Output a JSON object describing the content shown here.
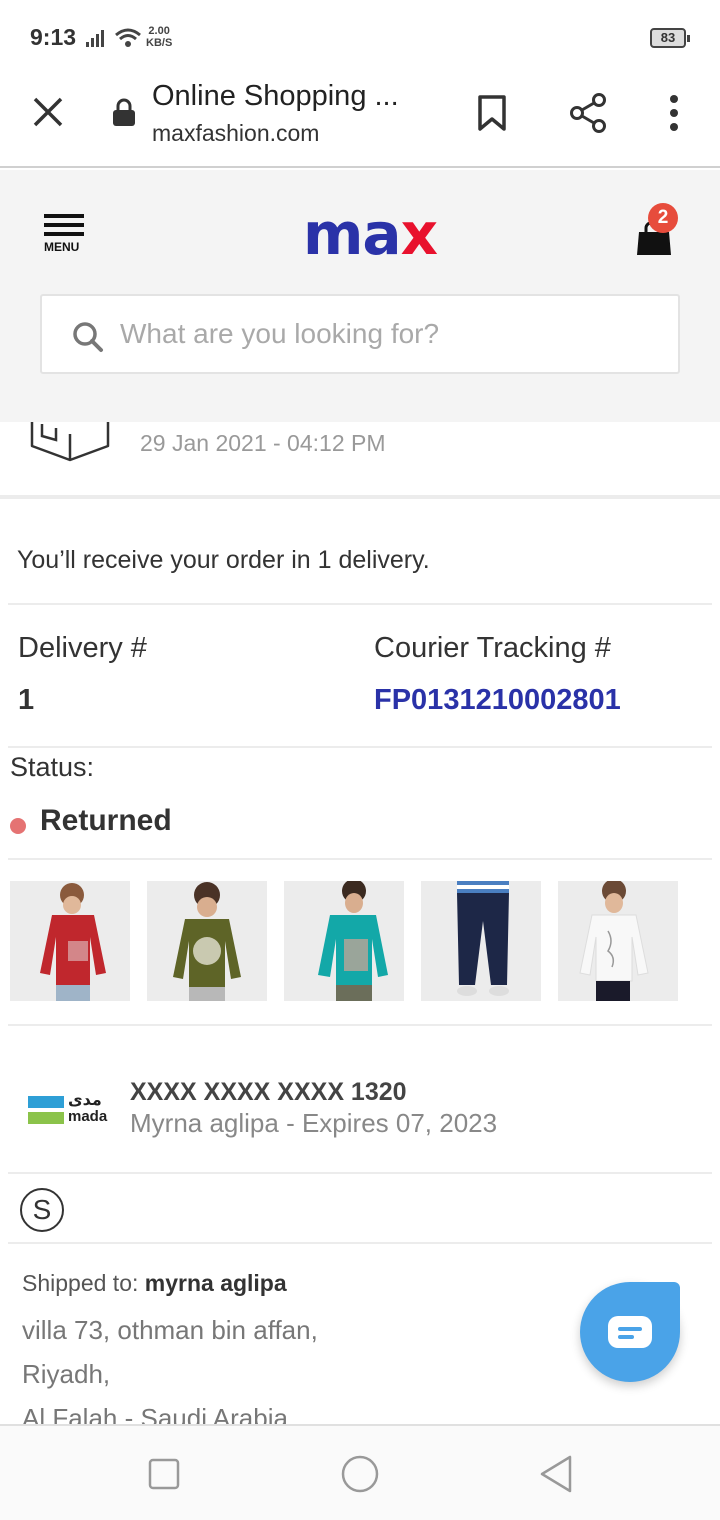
{
  "status_bar": {
    "time": "9:13",
    "net_speed_value": "2.00",
    "net_speed_unit": "KB/S",
    "battery": "83"
  },
  "browser": {
    "title": "Online Shopping ...",
    "url": "maxfashion.com"
  },
  "header": {
    "menu_label": "MENU",
    "logo_part1": "ma",
    "logo_part2": "x",
    "cart_count": "2",
    "search_placeholder": "What are you looking for?"
  },
  "order": {
    "date": "29 Jan 2021 - 04:12 PM",
    "delivery_message": "You’ll receive your order in 1 delivery.",
    "delivery_label": "Delivery #",
    "delivery_number": "1",
    "tracking_label": "Courier Tracking #",
    "tracking_number": "FP0131210002801",
    "status_label": "Status:",
    "status_value": "Returned",
    "status_color": "#e57373"
  },
  "products": [
    {
      "name": "red-long-sleeve-tee",
      "color": "#c0272d"
    },
    {
      "name": "olive-tiger-print-tee",
      "color": "#5e6427"
    },
    {
      "name": "teal-graphic-tee",
      "color": "#13a8a8"
    },
    {
      "name": "navy-jogger-pants",
      "color": "#1d2747"
    },
    {
      "name": "white-script-tee",
      "color": "#f4f4f4"
    }
  ],
  "payment": {
    "brand_arabic": "مدى",
    "brand": "mada",
    "card_number": "XXXX XXXX XXXX 1320",
    "card_holder": "Myrna aglipa - Expires 07, 2023",
    "currency_symbol": "S"
  },
  "shipping": {
    "label": "Shipped to:",
    "name": "myrna aglipa",
    "line1": "villa 73, othman bin affan,",
    "line2": "Riyadh,",
    "line3": "Al Falah - Saudi Arabia"
  },
  "colors": {
    "brand_blue": "#2a32a8",
    "brand_red": "#e8112d",
    "chat_blue": "#4aa3e8"
  }
}
